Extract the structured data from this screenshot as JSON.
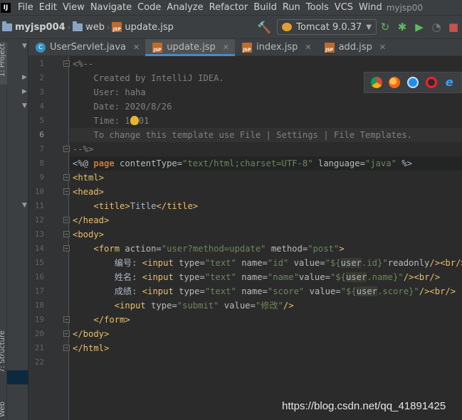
{
  "menu": {
    "items": [
      "File",
      "Edit",
      "View",
      "Navigate",
      "Code",
      "Analyze",
      "Refactor",
      "Build",
      "Run",
      "Tools",
      "VCS",
      "Wind"
    ],
    "window_title": "myjsp00"
  },
  "breadcrumb": {
    "project": "myjsp004",
    "folder": "web",
    "file": "update.jsp"
  },
  "run_config": {
    "label": "Tomcat 9.0.37"
  },
  "tool_strip": {
    "project_label": "1: Project",
    "structure_label": "7: Structure",
    "web_label": "Web"
  },
  "tabs": [
    {
      "label": "UserServlet.java",
      "icon": "java-class-icon",
      "active": false
    },
    {
      "label": "update.jsp",
      "icon": "jsp-file-icon",
      "active": true
    },
    {
      "label": "index.jsp",
      "icon": "jsp-file-icon",
      "active": false
    },
    {
      "label": "add.jsp",
      "icon": "jsp-file-icon",
      "active": false
    }
  ],
  "browser_icons": [
    "chrome-icon",
    "firefox-icon",
    "safari-icon",
    "opera-icon",
    "edge-icon"
  ],
  "colors": {
    "accent": "#4a88c7",
    "background": "#2b2b2b",
    "tag": "#e8bf6a",
    "string": "#6a8759",
    "keyword": "#cc7832",
    "comment": "#808080"
  },
  "code": {
    "l1": "<%--",
    "l2": "Created by IntelliJ IDEA.",
    "l3": "User: haha",
    "l4": "Date: 2020/8/26",
    "l5a": "Time: 1",
    "l5b": "01",
    "l6": "To change this template use File | Settings | File Templates.",
    "l7": "--%>",
    "l8_open": "<%@ ",
    "l8_kw": "page",
    "l8_a1": " contentType=",
    "l8_v1": "\"text/html;charset=UTF-8\"",
    "l8_a2": " language=",
    "l8_v2": "\"java\"",
    "l8_close": " %>",
    "l9": "<html>",
    "l10": "<head>",
    "l11_open": "<title>",
    "l11_text": "Title",
    "l11_close": "</title>",
    "l12": "</head>",
    "l13": "<body>",
    "l14_tag": "<form",
    "l14_a1": " action=",
    "l14_v1": "\"user?method=update\"",
    "l14_a2": " method=",
    "l14_v2": "\"post\"",
    "l14_end": ">",
    "l15_label": "编号:",
    "l15_tag": "<input",
    "l15_a1": " type=",
    "l15_v1": "\"text\"",
    "l15_a2": " name=",
    "l15_v2": "\"id\"",
    "l15_a3": " value=",
    "l15_v3a": "\"${",
    "l15_el": "user",
    "l15_v3b": ".id}\"",
    "l15_a4": "readonly",
    "l15_end": "/>",
    "l15_br": "<br/>",
    "l16_label": "姓名:",
    "l16_tag": "<input",
    "l16_a1": " type=",
    "l16_v1": "\"text\"",
    "l16_a2": " name=",
    "l16_v2": "\"name\"",
    "l16_a3": "value=",
    "l16_v3a": "\"${",
    "l16_el": "user",
    "l16_v3b": ".name}\"",
    "l16_end": "/>",
    "l16_br": "<br/>",
    "l17_label": "成绩:",
    "l17_tag": "<input",
    "l17_a1": " type=",
    "l17_v1": "\"text\"",
    "l17_a2": " name=",
    "l17_v2": "\"score\"",
    "l17_a3": " value=",
    "l17_v3a": "\"${",
    "l17_el": "user",
    "l17_v3b": ".score}\"",
    "l17_end": "/>",
    "l17_br": "<br/>",
    "l18_tag": "<input",
    "l18_a1": " type=",
    "l18_v1": "\"submit\"",
    "l18_a2": " value=",
    "l18_v2": "\"修改\"",
    "l18_end": "/>",
    "l19": "</form>",
    "l20": "</body>",
    "l21": "</html>"
  },
  "line_numbers": [
    "1",
    "2",
    "3",
    "4",
    "5",
    "6",
    "7",
    "8",
    "9",
    "10",
    "11",
    "12",
    "13",
    "14",
    "15",
    "16",
    "17",
    "18",
    "19",
    "20",
    "21",
    "22"
  ],
  "watermark": "https://blog.csdn.net/qq_41891425"
}
